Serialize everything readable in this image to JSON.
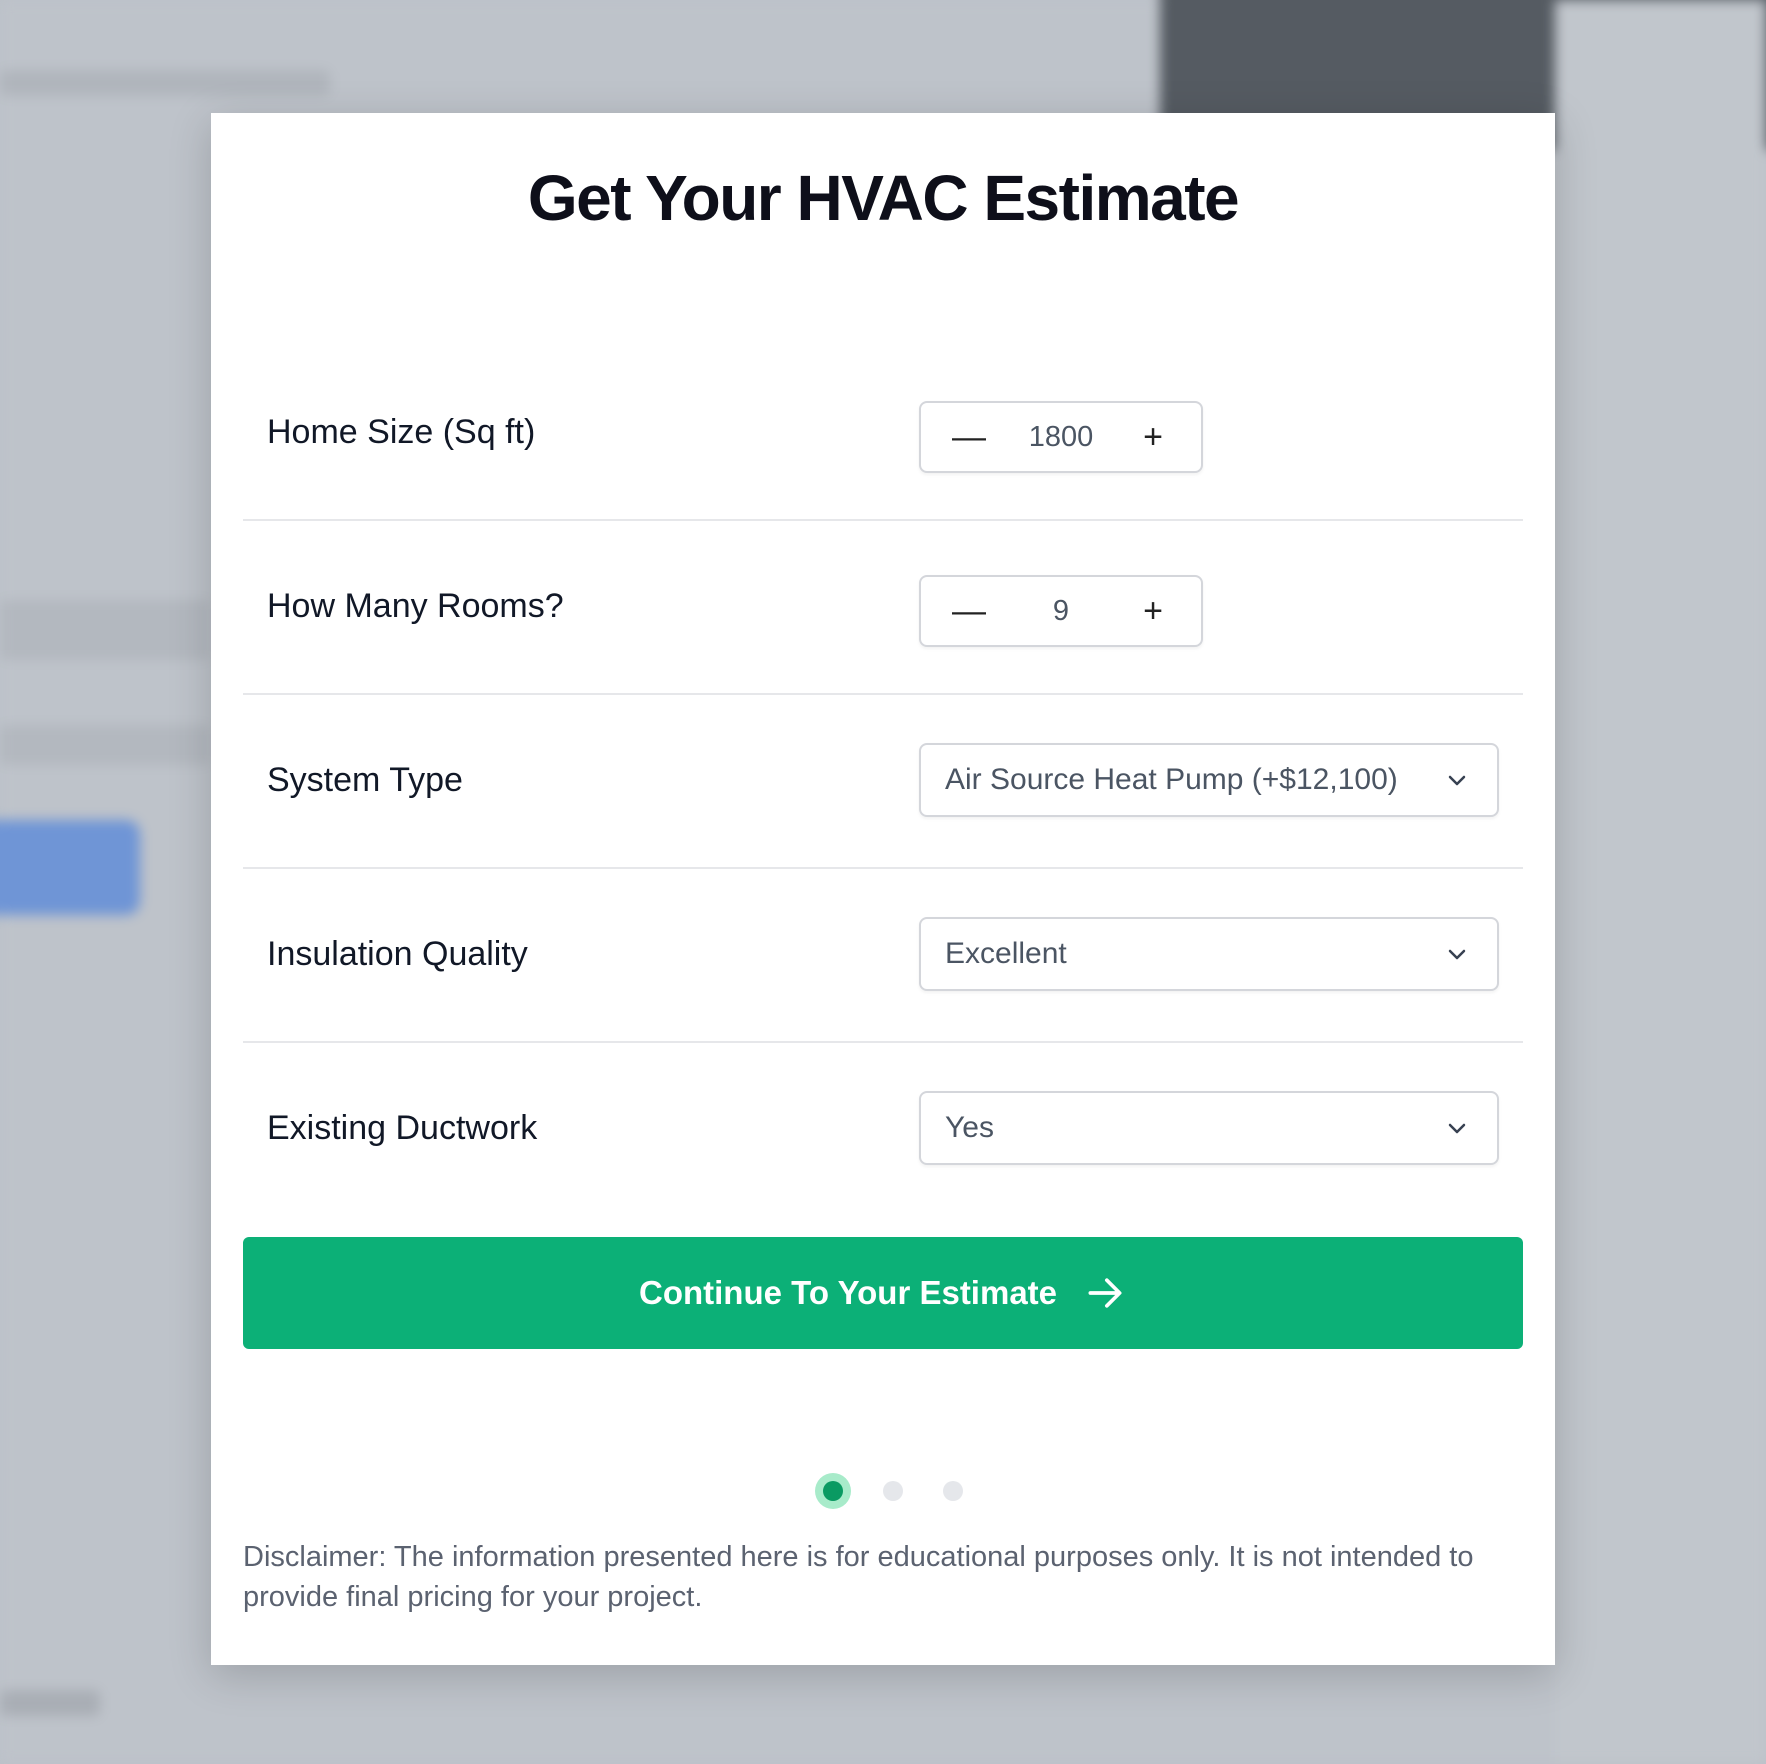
{
  "title": "Get Your HVAC Estimate",
  "fields": {
    "home_size": {
      "label": "Home Size (Sq ft)",
      "value": "1800",
      "decrement": "—",
      "increment": "+"
    },
    "rooms": {
      "label": "How Many Rooms?",
      "value": "9",
      "decrement": "—",
      "increment": "+"
    },
    "system_type": {
      "label": "System Type",
      "value": "Air Source Heat Pump (+$12,100)"
    },
    "insulation": {
      "label": "Insulation Quality",
      "value": "Excellent"
    },
    "ductwork": {
      "label": "Existing Ductwork",
      "value": "Yes"
    }
  },
  "cta": {
    "label": "Continue To Your Estimate"
  },
  "pagination": {
    "current": 1,
    "total": 3
  },
  "disclaimer": "Disclaimer: The information presented here is for educational purposes only. It is not intended to provide final pricing for your project.",
  "colors": {
    "accent": "#0cb077",
    "dot_active": "#0a9a62",
    "dot_ring": "#a8ebca",
    "title": "#0e0f1a"
  },
  "icons": {
    "chevron": "chevron-down-icon",
    "arrow": "arrow-right-icon"
  }
}
